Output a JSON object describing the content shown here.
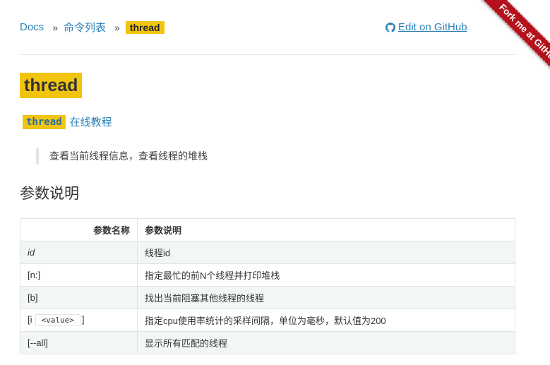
{
  "breadcrumb": {
    "docs": "Docs",
    "sep1": "»",
    "list": "命令列表",
    "sep2": "»",
    "current": "thread"
  },
  "header": {
    "edit_label": "Edit on GitHub",
    "ribbon": "Fork me at GitHub"
  },
  "title": "thread",
  "tutorial": {
    "code": "thread",
    "link": "在线教程"
  },
  "description": "查看当前线程信息，查看线程的堆栈",
  "section_title": "参数说明",
  "table": {
    "headers": [
      "参数名称",
      "参数说明"
    ],
    "rows": [
      {
        "name": "id",
        "desc": "线程id"
      },
      {
        "name": "[n:]",
        "desc": "指定最忙的前N个线程并打印堆栈"
      },
      {
        "name": "[b]",
        "desc": "找出当前阻塞其他线程的线程"
      },
      {
        "name_prefix": "[i",
        "name_code": "<value>",
        "name_suffix": "]",
        "desc": "指定cpu使用率统计的采样间隔，单位为毫秒，默认值为200"
      },
      {
        "name": "[--all]",
        "desc": "显示所有匹配的线程"
      }
    ]
  },
  "colors": {
    "accent": "#2980b9",
    "highlight": "#f1c40f",
    "ribbon": "#b3111b"
  },
  "icons": {
    "edit": "github-icon"
  }
}
